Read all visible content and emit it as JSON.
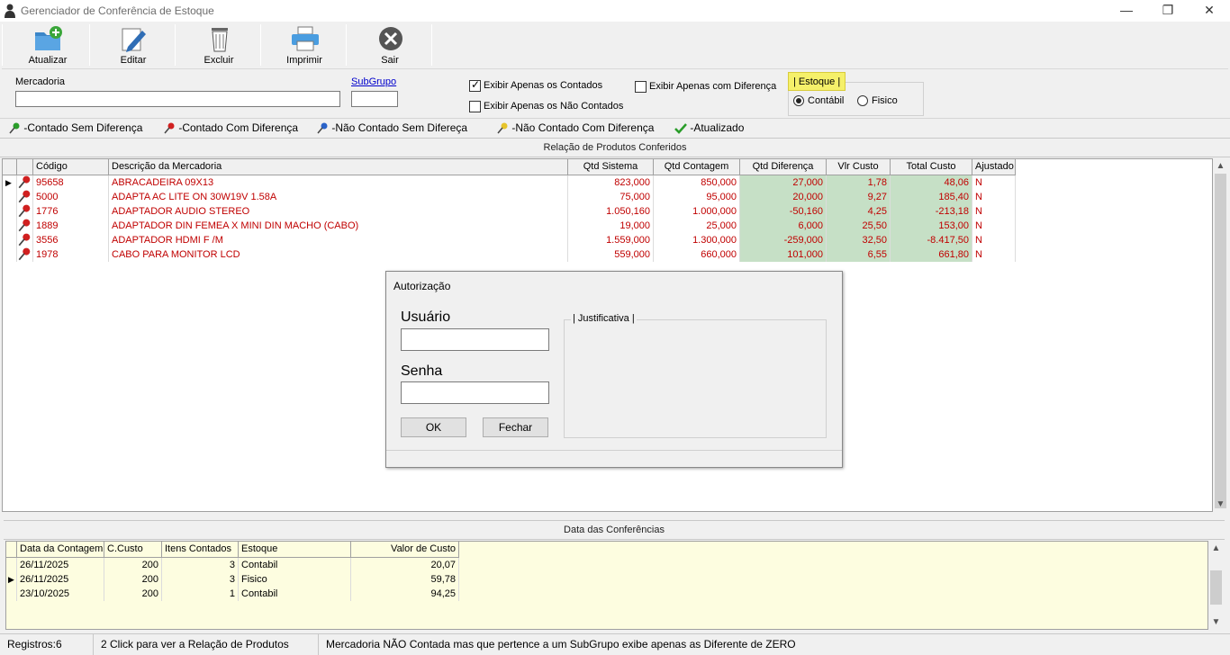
{
  "window": {
    "title": "Gerenciador de Conferência de Estoque"
  },
  "toolbar": {
    "buttons": [
      {
        "label": "Atualizar",
        "icon": "folder-add-icon"
      },
      {
        "label": "Editar",
        "icon": "edit-pencil-icon"
      },
      {
        "label": "Excluir",
        "icon": "trash-icon"
      },
      {
        "label": "Imprimir",
        "icon": "printer-icon"
      },
      {
        "label": "Sair",
        "icon": "exit-icon"
      }
    ]
  },
  "filters": {
    "mercadoria_label": "Mercadoria",
    "mercadoria_value": "",
    "subgrupo_label": "SubGrupo",
    "subgrupo_value": "",
    "exibir_contados": "Exibir Apenas os Contados",
    "exibir_nao_contados": "Exibir Apenas os Não Contados",
    "exibir_diferenca": "Exibir Apenas com Diferença",
    "estoque_group": "| Estoque |",
    "contabil": "Contábil",
    "fisico": "Fisico"
  },
  "legend": {
    "item1": "-Contado Sem Diferença",
    "item2": "-Contado Com Diferença",
    "item3": "-Não Contado Sem Difereça",
    "item4": "-Não Contado Com Diferença",
    "item5": "-Atualizado"
  },
  "products": {
    "title": "Relação de Produtos Conferidos",
    "columns": [
      "Código",
      "Descrição da Mercadoria",
      "Qtd Sistema",
      "Qtd Contagem",
      "Qtd Diferença",
      "Vlr Custo",
      "Total Custo",
      "Ajustado"
    ],
    "rows": [
      [
        "95658",
        "ABRACADEIRA 09X13",
        "823,000",
        "850,000",
        "27,000",
        "1,78",
        "48,06",
        "N"
      ],
      [
        "5000",
        "ADAPTA AC LITE ON 30W19V 1.58A",
        "75,000",
        "95,000",
        "20,000",
        "9,27",
        "185,40",
        "N"
      ],
      [
        "1776",
        "ADAPTADOR AUDIO STEREO",
        "1.050,160",
        "1.000,000",
        "-50,160",
        "4,25",
        "-213,18",
        "N"
      ],
      [
        "1889",
        "ADAPTADOR DIN FEMEA X MINI DIN MACHO (CABO)",
        "19,000",
        "25,000",
        "6,000",
        "25,50",
        "153,00",
        "N"
      ],
      [
        "3556",
        "ADAPTADOR HDMI F /M",
        "1.559,000",
        "1.300,000",
        "-259,000",
        "32,50",
        "-8.417,50",
        "N"
      ],
      [
        "1978",
        "CABO PARA MONITOR LCD",
        "559,000",
        "660,000",
        "101,000",
        "6,55",
        "661,80",
        "N"
      ]
    ]
  },
  "conferencias": {
    "title": "Data das Conferências",
    "columns": [
      "Data da Contagem",
      "C.Custo",
      "Itens Contados",
      "Estoque",
      "Valor de Custo"
    ],
    "rows": [
      [
        "26/11/2025",
        "200",
        "3",
        "Contabil",
        "20,07"
      ],
      [
        "26/11/2025",
        "200",
        "3",
        "Fisico",
        "59,78"
      ],
      [
        "23/10/2025",
        "200",
        "1",
        "Contabil",
        "94,25"
      ]
    ]
  },
  "dialog": {
    "title": "Autorização",
    "usuario_label": "Usuário",
    "usuario_value": "",
    "senha_label": "Senha",
    "senha_value": "",
    "justificativa_label": "| Justificativa |",
    "ok": "OK",
    "fechar": "Fechar"
  },
  "status": {
    "registros": "Registros:6",
    "hint1": "2 Click para ver a Relação de Produtos",
    "hint2": "Mercadoria NÃO Contada mas que pertence a um SubGrupo exibe apenas as Diferente de ZERO"
  },
  "colors": {
    "red_text": "#c00000",
    "green_cell": "#c6e0c6",
    "cream_grid": "#fdfde0",
    "highlight_yellow": "#f5f06a"
  }
}
